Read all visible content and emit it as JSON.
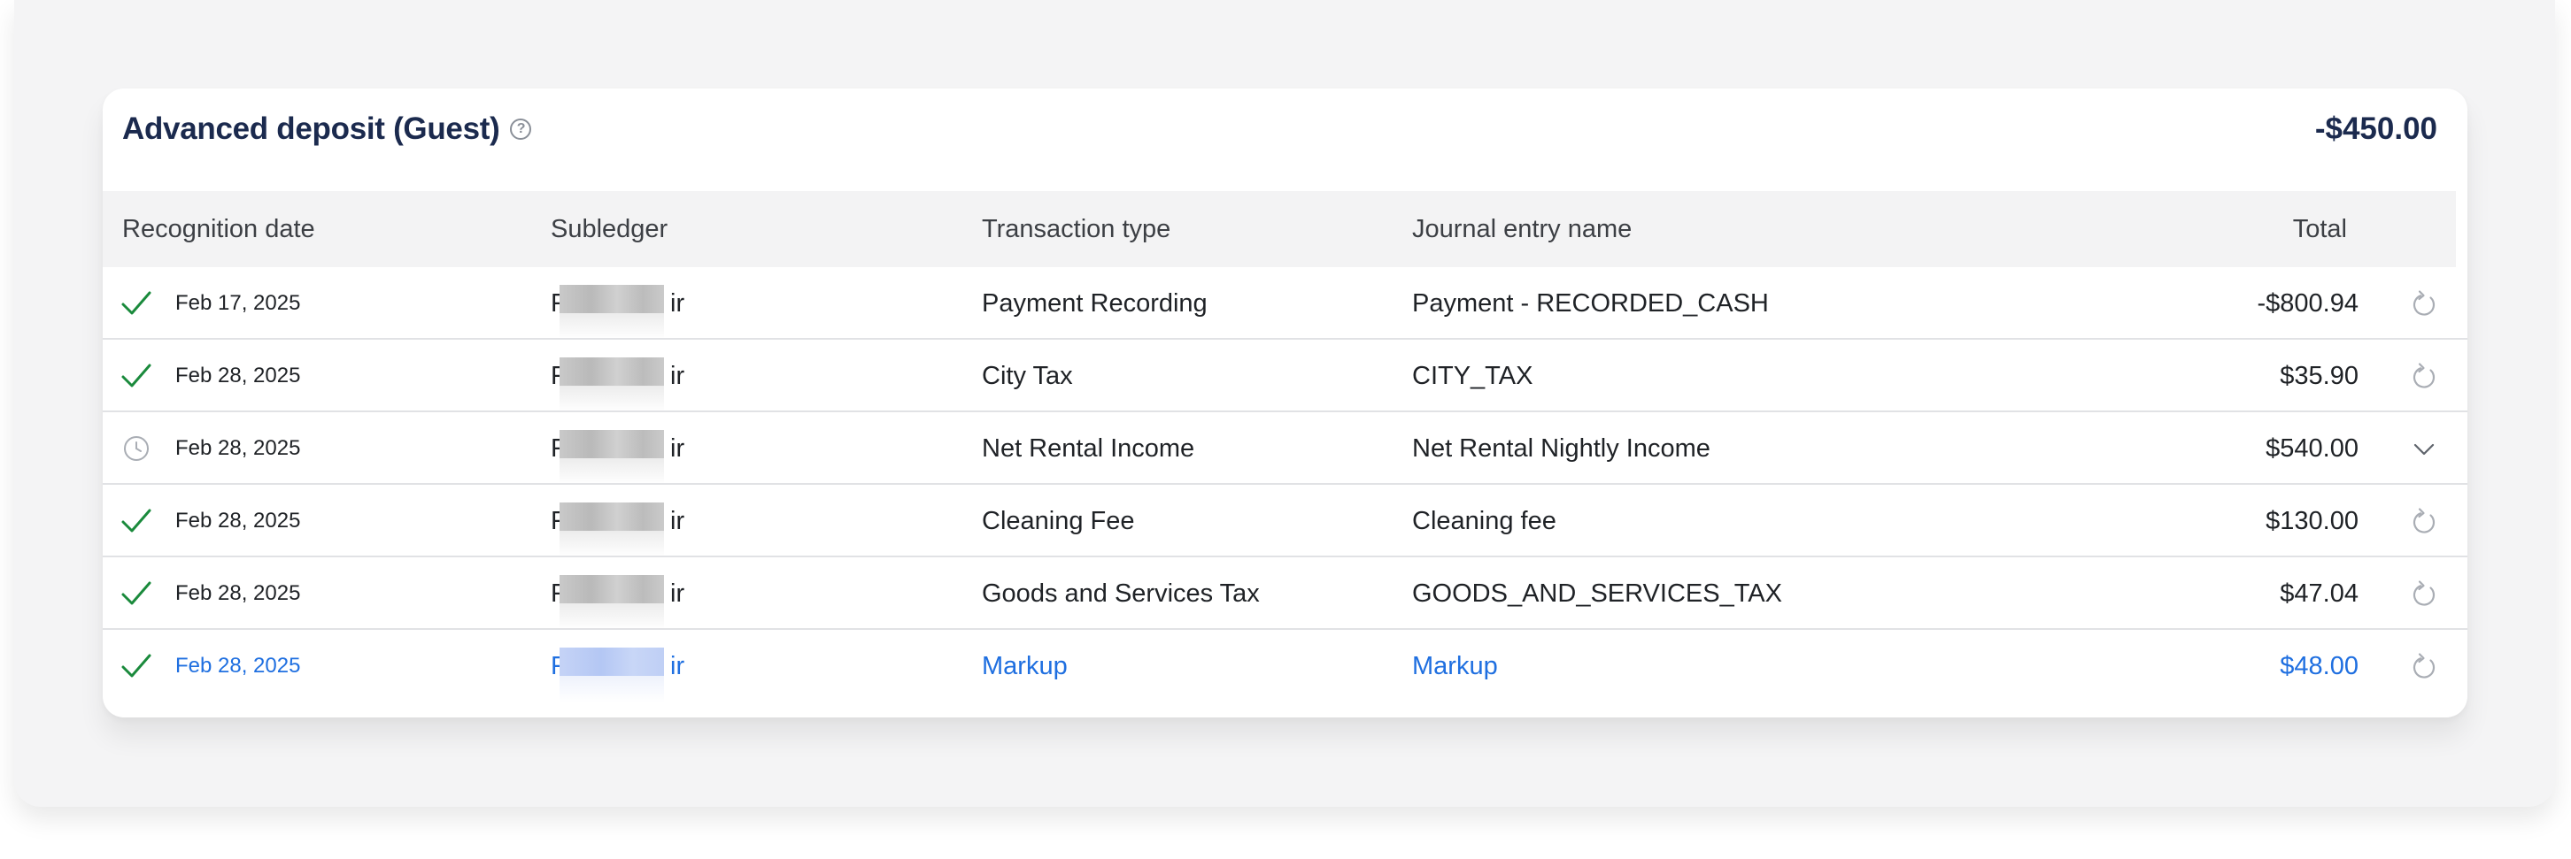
{
  "section": {
    "title": "Advanced deposit (Guest)",
    "help_icon": "help-circle-icon",
    "total": "-$450.00"
  },
  "columns": {
    "recognition_date": "Recognition date",
    "subledger": "Subledger",
    "transaction_type": "Transaction type",
    "journal_entry_name": "Journal entry name",
    "total": "Total"
  },
  "rows": [
    {
      "status": "check-icon",
      "date": "Feb 17, 2025",
      "sub_first": "F",
      "sub_last": "ir",
      "transaction_type": "Payment Recording",
      "journal_entry_name": "Payment - RECORDED_CASH",
      "total": "-$800.94",
      "action": "refresh-icon"
    },
    {
      "status": "check-icon",
      "date": "Feb 28, 2025",
      "sub_first": "F",
      "sub_last": "ir",
      "transaction_type": "City Tax",
      "journal_entry_name": "CITY_TAX",
      "total": "$35.90",
      "action": "refresh-icon"
    },
    {
      "status": "clock-icon",
      "date": "Feb 28, 2025",
      "sub_first": "F",
      "sub_last": "ir",
      "transaction_type": "Net Rental Income",
      "journal_entry_name": "Net Rental Nightly Income",
      "total": "$540.00",
      "action": "chevron-down-icon"
    },
    {
      "status": "check-icon",
      "date": "Feb 28, 2025",
      "sub_first": "F",
      "sub_last": "ir",
      "transaction_type": "Cleaning Fee",
      "journal_entry_name": "Cleaning fee",
      "total": "$130.00",
      "action": "refresh-icon"
    },
    {
      "status": "check-icon",
      "date": "Feb 28, 2025",
      "sub_first": "F",
      "sub_last": "ir",
      "transaction_type": "Goods and Services Tax",
      "journal_entry_name": "GOODS_AND_SERVICES_TAX",
      "total": "$47.04",
      "action": "refresh-icon"
    },
    {
      "status": "check-icon",
      "date": "Feb 28, 2025",
      "sub_first": "F",
      "sub_last": "ir",
      "transaction_type": "Markup",
      "journal_entry_name": "Markup",
      "total": "$48.00",
      "action": "refresh-icon",
      "highlighted": true
    }
  ],
  "colors": {
    "title": "#1b2a4e",
    "check": "#1a8a3c",
    "link_blue": "#1f6fe0",
    "muted_icon": "#a9adb4",
    "header_bg": "#f3f3f4"
  }
}
